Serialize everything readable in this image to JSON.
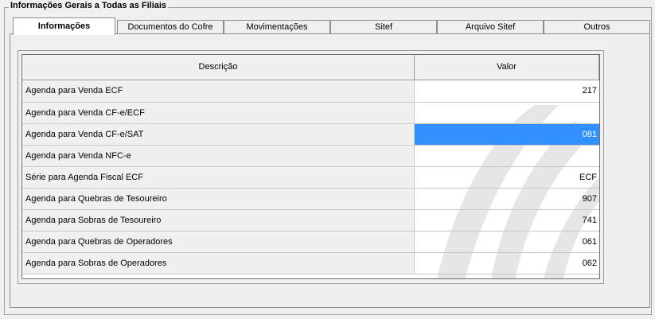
{
  "group": {
    "title": "Informações Gerais a Todas as Filiais"
  },
  "tabs": [
    {
      "label": "Informações",
      "active": true
    },
    {
      "label": "Documentos do Cofre",
      "active": false
    },
    {
      "label": "Movimentações",
      "active": false
    },
    {
      "label": "Sitef",
      "active": false
    },
    {
      "label": "Arquivo  Sitef",
      "active": false
    },
    {
      "label": "Outros",
      "active": false
    }
  ],
  "grid": {
    "columns": [
      "Descrição",
      "Valor"
    ],
    "rows": [
      {
        "descricao": "Agenda para Venda ECF",
        "valor": "217"
      },
      {
        "descricao": "Agenda para Venda CF-e/ECF",
        "valor": ""
      },
      {
        "descricao": "Agenda para Venda CF-e/SAT",
        "valor": "081",
        "selected": true
      },
      {
        "descricao": "Agenda para Venda NFC-e",
        "valor": ""
      },
      {
        "descricao": "Série para Agenda Fiscal ECF",
        "valor": "ECF"
      },
      {
        "descricao": "Agenda para Quebras de Tesoureiro",
        "valor": "907"
      },
      {
        "descricao": "Agenda para Sobras de Tesoureiro",
        "valor": "741"
      },
      {
        "descricao": "Agenda para Quebras de Operadores",
        "valor": "061"
      },
      {
        "descricao": "Agenda para Sobras de Operadores",
        "valor": "062"
      }
    ]
  },
  "colors": {
    "selection": "#3390ff",
    "panel": "#f0f0f0"
  }
}
